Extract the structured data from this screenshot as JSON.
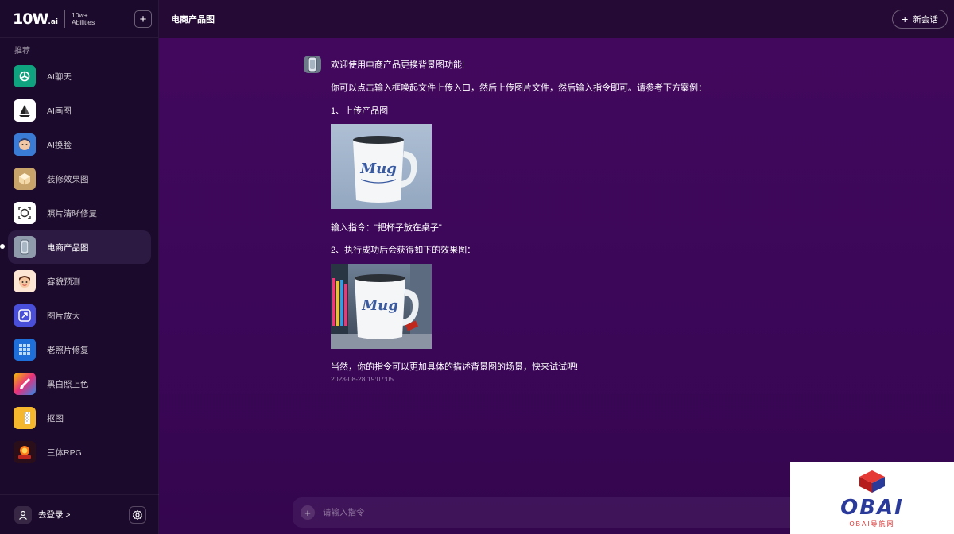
{
  "brand": {
    "logo_main": "10W",
    "logo_suffix": ".ai",
    "line1": "10w+",
    "line2": "Abilities"
  },
  "sidebar": {
    "section_label": "推荐",
    "items": [
      {
        "label": "AI聊天",
        "icon": "chatgpt-icon"
      },
      {
        "label": "AI画图",
        "icon": "sailboat-icon"
      },
      {
        "label": "AI换脸",
        "icon": "face-avatar-icon"
      },
      {
        "label": "装修效果图",
        "icon": "cube-icon"
      },
      {
        "label": "照片清晰修复",
        "icon": "focus-target-icon"
      },
      {
        "label": "电商产品图",
        "icon": "product-icon"
      },
      {
        "label": "容貌预测",
        "icon": "cartoon-face-icon"
      },
      {
        "label": "图片放大",
        "icon": "enlarge-icon"
      },
      {
        "label": "老照片修复",
        "icon": "grid-photo-icon"
      },
      {
        "label": "黑白照上色",
        "icon": "paint-brush-icon"
      },
      {
        "label": "抠图",
        "icon": "cutout-icon"
      },
      {
        "label": "三体RPG",
        "icon": "game-icon"
      }
    ],
    "active_index": 5,
    "footer": {
      "login_label": "去登录 >"
    }
  },
  "topbar": {
    "title": "电商产品图",
    "new_chat_label": "新会话"
  },
  "message": {
    "line1": "欢迎使用电商产品更换背景图功能!",
    "line2": "你可以点击输入框唤起文件上传入口，然后上传图片文件，然后输入指令即可。请参考下方案例：",
    "step1": "1、上传产品图",
    "image1_text": "Mug",
    "instruction": "输入指令：\"把杯子放在桌子\"",
    "step2": "2、执行成功后会获得如下的效果图：",
    "image2_text": "Mug",
    "closing": "当然，你的指令可以更加具体的描述背景图的场景，快来试试吧!",
    "timestamp": "2023-08-28 19:07:05"
  },
  "input": {
    "placeholder": "请输入指令"
  },
  "watermark": {
    "text": "OBAI",
    "sub": "OBAI导航网"
  },
  "colors": {
    "sidebar_bg": "#1c0a2c",
    "main_bg": "#3b0758",
    "topbar_bg": "#240a34",
    "active_item": "#2d1a42"
  }
}
